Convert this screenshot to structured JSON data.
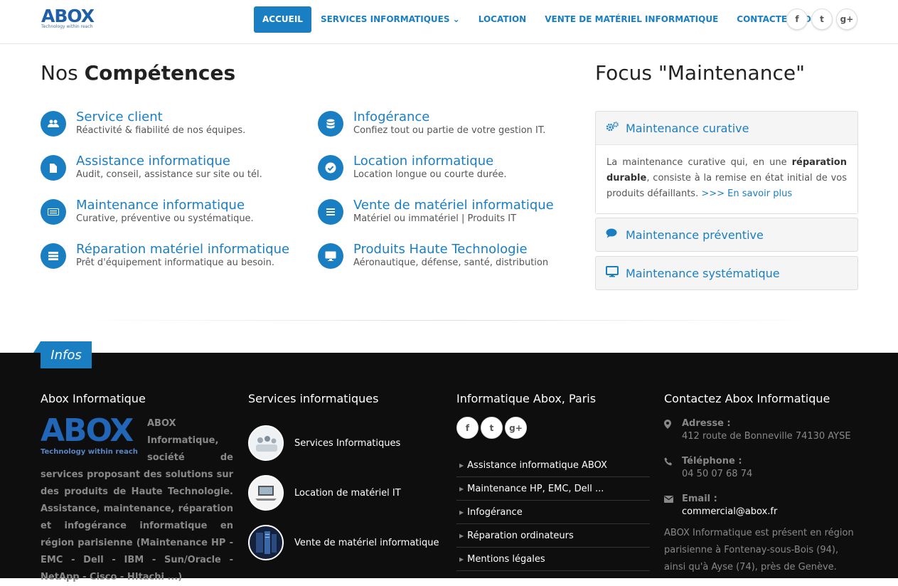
{
  "header": {
    "logo_text": "ABOX",
    "logo_tagline": "Technology within reach",
    "nav": [
      {
        "label": "ACCUEIL",
        "active": true
      },
      {
        "label": "SERVICES INFORMATIQUES ⌄",
        "active": false
      },
      {
        "label": "LOCATION",
        "active": false
      },
      {
        "label": "VENTE DE MATÉRIEL INFORMATIQUE",
        "active": false
      },
      {
        "label": "CONTACTEZ-NOUS",
        "active": false
      }
    ],
    "social": [
      {
        "icon": "facebook-icon",
        "glyph": "f"
      },
      {
        "icon": "twitter-icon",
        "glyph": "t"
      },
      {
        "icon": "google-plus-icon",
        "glyph": "g+"
      }
    ]
  },
  "competences": {
    "title_prefix": "Nos ",
    "title_bold": "Compétences",
    "items": [
      {
        "title": "Service client",
        "desc": "Réactivité & fiabilité de nos équipes.",
        "icon": "users-icon"
      },
      {
        "title": "Infogérance",
        "desc": "Confiez tout ou partie de votre gestion IT.",
        "icon": "database-icon"
      },
      {
        "title": "Assistance informatique",
        "desc": "Audit, conseil, assistance sur site ou tél.",
        "icon": "file-icon"
      },
      {
        "title": "Location informatique",
        "desc": "Location longue ou courte durée.",
        "icon": "check-icon"
      },
      {
        "title": "Maintenance informatique",
        "desc": "Curative, préventive ou systématique.",
        "icon": "keyboard-icon"
      },
      {
        "title": "Vente de matériel informatique",
        "desc": "Matériel ou immatériel | Produits IT",
        "icon": "list-icon"
      },
      {
        "title": "Réparation matériel informatique",
        "desc": "Prêt d'équipement informatique au besoin.",
        "icon": "server-icon"
      },
      {
        "title": "Produits Haute Technologie",
        "desc": "Aéronautique, défense, santé, distribution",
        "icon": "desktop-icon"
      }
    ]
  },
  "focus": {
    "title": "Focus \"Maintenance\"",
    "panels": [
      {
        "title": "Maintenance curative",
        "icon": "cogs-icon",
        "expanded": true,
        "body_1": "La maintenance curative qui, en une ",
        "body_bold": "réparation durable",
        "body_2": ", consiste à la remise en état initial de vos produits défaillants. ",
        "more": ">>> En savoir plus"
      },
      {
        "title": "Maintenance préventive",
        "icon": "comment-icon",
        "expanded": false
      },
      {
        "title": "Maintenance systématique",
        "icon": "desktop-icon",
        "expanded": false
      }
    ]
  },
  "footer": {
    "tab_label": "Infos",
    "col1": {
      "title": "Abox Informatique",
      "logo_text": "ABOX",
      "logo_tagline": "Technology within reach",
      "about": "ABOX Informatique, société de services proposant des solutions sur des produits de Haute Technologie. Assistance, maintenance, réparation et infogérance informatique en région parisienne (Maintenance HP - EMC - Dell - IBM - Sun/Oracle - NetApp - Cisco - HItachi ...)"
    },
    "col2": {
      "title": "Services informatiques",
      "items": [
        {
          "label": "Services Informatiques",
          "icon": "meeting-photo-icon"
        },
        {
          "label": "Location de matériel IT",
          "icon": "laptop-photo-icon"
        },
        {
          "label": "Vente de matériel informatique",
          "icon": "server-photo-icon"
        }
      ]
    },
    "col3": {
      "title": "Informatique Abox, Paris",
      "social": [
        {
          "icon": "facebook-icon",
          "glyph": "f"
        },
        {
          "icon": "twitter-icon",
          "glyph": "t"
        },
        {
          "icon": "google-plus-icon",
          "glyph": "g+"
        }
      ],
      "links": [
        "Assistance informatique ABOX",
        "Maintenance HP, EMC, Dell ...",
        "Infogérance",
        "Réparation ordinateurs",
        "Mentions légales"
      ]
    },
    "col4": {
      "title": "Contactez Abox Informatique",
      "address_label": "Adresse :",
      "address": "412 route de Bonneville 74130 AYSE",
      "phone_label": "Téléphone :",
      "phone": "04 50 07 68 74",
      "email_label": "Email :",
      "email": "commercial@abox.fr",
      "text": "ABOX Informatique est présent en région parisienne à Fontenay-sous-Bois (94), ainsi qu'à Ayse (74), près de Genève."
    }
  }
}
